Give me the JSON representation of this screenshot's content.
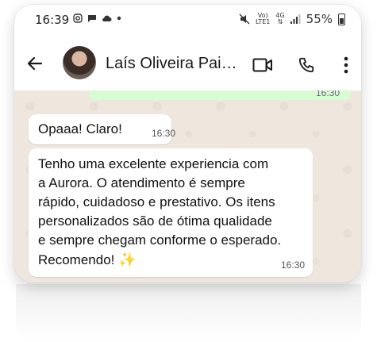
{
  "status_bar": {
    "time": "16:39",
    "left_icons": [
      "instagram-icon",
      "message-icon",
      "cloud-icon",
      "dot-icon"
    ],
    "network_top": "Vo)",
    "network_bottom": "LTE1",
    "network_gen": "4G",
    "battery": "55%"
  },
  "header": {
    "contact_name": "Laís Oliveira Paiol..."
  },
  "messages": [
    {
      "text": "Opaaa! Claro!",
      "time": "16:30"
    },
    {
      "text": "Tenho uma excelente experiencia com\na Aurora. O atendimento é sempre\nrápido, cuidadoso e prestativo. Os itens\npersonalizados são de ótima qualidade\ne sempre chegam conforme o esperado.\nRecomendo! ",
      "emoji": "✨",
      "time": "16:30"
    }
  ],
  "previous_message": {
    "time": "16:30"
  },
  "colors": {
    "chat_bg": "#efe7de",
    "incoming_bubble": "#ffffff",
    "outgoing_bubble": "#d9fdd3"
  }
}
